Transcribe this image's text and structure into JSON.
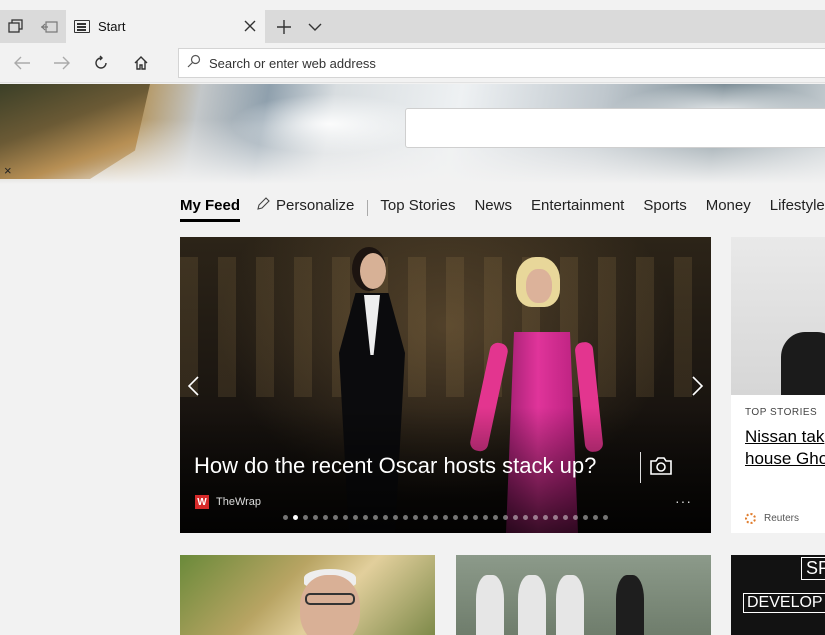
{
  "browser": {
    "tab": {
      "title": "Start"
    },
    "address_bar": {
      "placeholder": "Search or enter web address"
    }
  },
  "feed": {
    "nav": {
      "my_feed": "My Feed",
      "personalize": "Personalize",
      "top_stories": "Top Stories",
      "news": "News",
      "entertainment": "Entertainment",
      "sports": "Sports",
      "money": "Money",
      "lifestyle": "Lifestyle"
    },
    "dismiss": "×",
    "hero_card": {
      "headline": "How do the recent Oscar hosts stack up?",
      "source": "TheWrap",
      "source_logo": "W",
      "more": "···",
      "slide_count": 33,
      "active_slide": 2
    },
    "side_card": {
      "category": "TOP STORIES",
      "title": "Nissan tak house Gho",
      "source": "Reuters"
    },
    "row2_card_c": {
      "top_text": "SP",
      "bottom_text": "DEVELOP"
    }
  },
  "colors": {
    "accent": "#d62a2a",
    "tabstrip": "#dadada",
    "background": "#f2f2f2",
    "dress_pink": "#e0349a"
  },
  "icons": {
    "set_aside": "set-aside-tabs-icon",
    "restore": "restore-tabs-icon",
    "back": "back-arrow-icon",
    "forward": "forward-arrow-icon",
    "refresh": "refresh-icon",
    "home": "home-icon",
    "search": "search-icon",
    "camera": "camera-icon"
  }
}
